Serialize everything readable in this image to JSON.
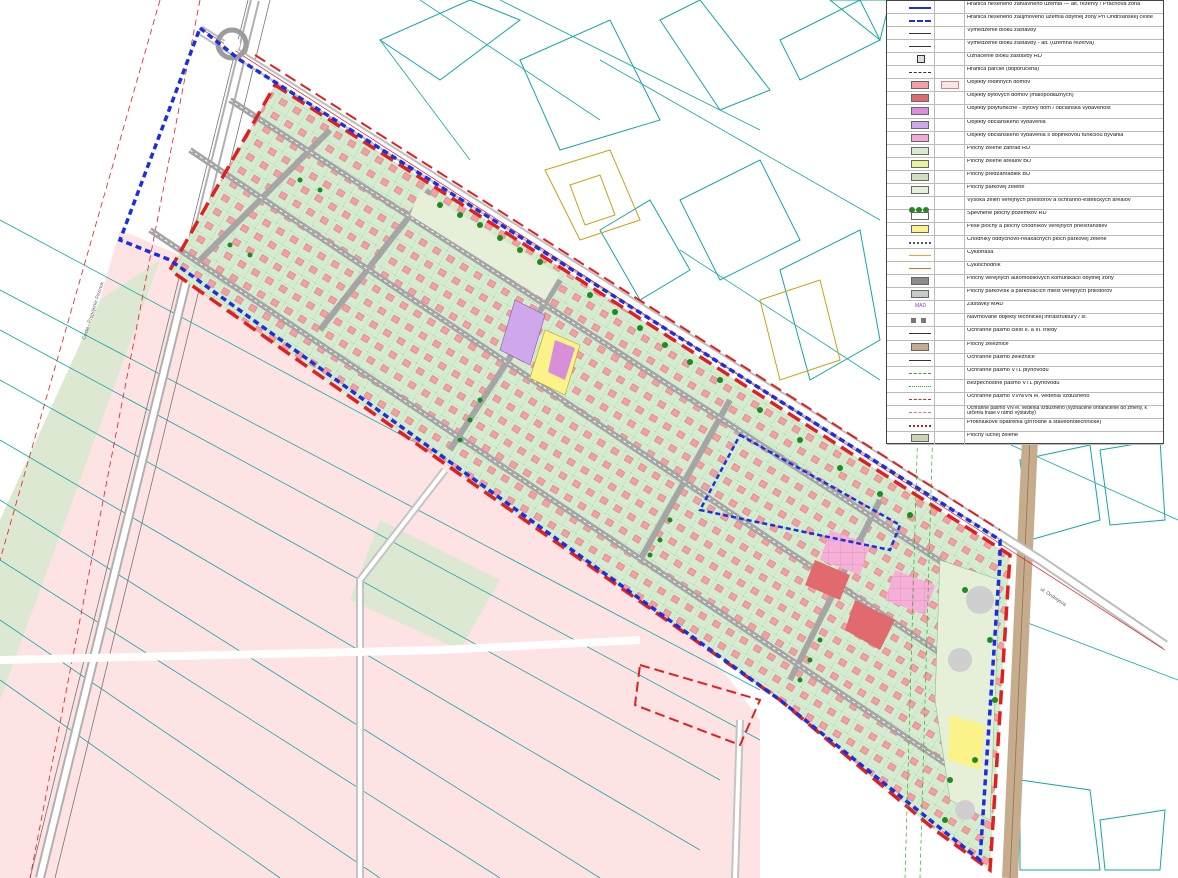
{
  "legend": {
    "items": [
      {
        "label": "Hranica riešeného zátvavného územia — alt. rezervy / Prachová zóna",
        "sym": "line-blue"
      },
      {
        "label": "Hranica riešeného záujmového územia obytnej zóny Pri Ondŕšanskej ceste",
        "sym": "line-blue-dashed"
      },
      {
        "label": "Vymedzenie bloku zástavby",
        "sym": "line-thin"
      },
      {
        "label": "Vymedzenie bloku zástavby - alt. (územná rezerva)",
        "sym": "line-thin"
      },
      {
        "label": "Označenie bloku zástavby RD",
        "sym": "box-mark"
      },
      {
        "label": "Hranica parciel (doporučená)",
        "sym": "line-dash"
      },
      {
        "label": "Objekty rodinných domov",
        "sym": "fill",
        "color": "#f2a0a2"
      },
      {
        "label": "Objekty bytových domov (malopodlažných)",
        "sym": "fill",
        "color": "#e06a6e"
      },
      {
        "label": "Objekty polyfunkčné - bytový dom / občianska vybavenosť",
        "sym": "fill",
        "color": "#d98ed9"
      },
      {
        "label": "Objekty občianskeho vybavenia",
        "sym": "fill",
        "color": "#cfa8ec"
      },
      {
        "label": "Objekty občianskeho vybavenia s doplnkovou funkciou bývania",
        "sym": "fill",
        "color": "#f5a9d6"
      },
      {
        "label": "Plochy zelene záhrad RD",
        "sym": "fill",
        "color": "#d6ecd0"
      },
      {
        "label": "Plochy zelene areálov BD",
        "sym": "fill",
        "color": "#e8f59a"
      },
      {
        "label": "Plochy predzáhradiek BD",
        "sym": "fill",
        "color": "#d3ddbc"
      },
      {
        "label": "Plochy parkovej zelene",
        "sym": "fill",
        "color": "#e6efd8"
      },
      {
        "label": "Vysoká zeleň verejných priestorov a ochranno-estetických areálov",
        "sym": "trees"
      },
      {
        "label": "Spevnené plochy pozemkov RD",
        "sym": "fill",
        "color": "#ffffff"
      },
      {
        "label": "Peše plochy a plochy chodníkov verejných priestranstiev",
        "sym": "fill",
        "color": "#fbf38a"
      },
      {
        "label": "Chodníky oddychovo-relaxačných plôch parkovej zelene",
        "sym": "line-dots"
      },
      {
        "label": "Cyklotrasa",
        "sym": "line-orange"
      },
      {
        "label": "Cyklochodník",
        "sym": "line-orange2"
      },
      {
        "label": "Plochy verejných automobilových komunikácií obytnej zóny",
        "sym": "fill",
        "color": "#8c8c8c"
      },
      {
        "label": "Plochy parkovísk a parkovacích miest verejných priestorov",
        "sym": "fill",
        "color": "#c8c8c8"
      },
      {
        "label": "Zastávky MAD",
        "sym": "mad",
        "text": "MAD"
      },
      {
        "label": "Navrhované objekty technickej infraštruktúry / sl.",
        "sym": "tech"
      },
      {
        "label": "Ochranné pásmo ciest II. a III. triedy",
        "sym": "line-thin"
      },
      {
        "label": "Plochy železnice",
        "sym": "fill",
        "color": "#c6ac8c"
      },
      {
        "label": "Ochranné pásmo železnice",
        "sym": "line-thin"
      },
      {
        "label": "Ochranné pásmo VTL plynovodu",
        "sym": "line-green"
      },
      {
        "label": "Bezpečnostné pásmo VTL plynovodu",
        "sym": "line-green2"
      },
      {
        "label": "Ochranné pásmo VVN/VN el. vedenia vzdušného",
        "sym": "line-red"
      },
      {
        "label": "Ochranné pásmo VN el. vedenia vzdušného (vyznačené ohraničenie do zmeny, k určeniu trase v rámci výstavby)",
        "sym": "line-red2"
      },
      {
        "label": "Protihlukové opatrenia (prírodné a stavebnotechnické)",
        "sym": "line-redzig"
      },
      {
        "label": "Plochy lúčnej zelene",
        "sym": "fill",
        "color": "#c9d6b5"
      }
    ]
  },
  "map_labels": {
    "road_left": "Cesta - Prepojenie Pezinok",
    "road_right": "ul. Ondrejova"
  },
  "colors": {
    "boundary_red": "#e02020",
    "boundary_blue": "#1c2fe0",
    "field_pink": "#fde3e3",
    "meadow": "#dfe8d4",
    "plot_green": "#d6ecd0",
    "house": "#f2a0a2",
    "road": "#a5a5a5",
    "tree": "#1f8a1f",
    "cadastre": "#17a6a6"
  }
}
